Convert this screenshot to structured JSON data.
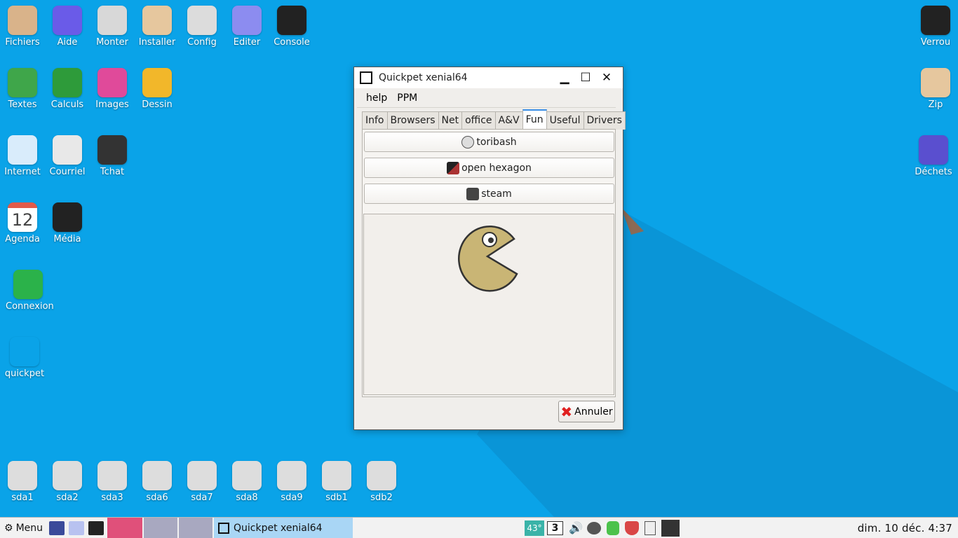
{
  "desktop": {
    "icons_top": [
      {
        "label": "Fichiers",
        "icon": "folder-home-icon",
        "color": "#d9b38a"
      },
      {
        "label": "Aide",
        "icon": "help-icon",
        "color": "#6a5be8"
      },
      {
        "label": "Monter",
        "icon": "drive-icon",
        "color": "#d8d8d8"
      },
      {
        "label": "Installer",
        "icon": "box-icon",
        "color": "#e6c79e"
      },
      {
        "label": "Config",
        "icon": "settings-icon",
        "color": "#dcdcdc"
      },
      {
        "label": "Editer",
        "icon": "editor-icon",
        "color": "#8c8cf0"
      },
      {
        "label": "Console",
        "icon": "terminal-icon",
        "color": "#222222"
      },
      {
        "label": "Textes",
        "icon": "writer-icon",
        "color": "#3fa64a"
      },
      {
        "label": "Calculs",
        "icon": "spreadsheet-icon",
        "color": "#2e9b3a"
      },
      {
        "label": "Images",
        "icon": "image-viewer-icon",
        "color": "#e04a9a"
      },
      {
        "label": "Dessin",
        "icon": "draw-icon",
        "color": "#f2b72a"
      },
      {
        "label": "Internet",
        "icon": "cloud-icon",
        "color": "#d9ecfb"
      },
      {
        "label": "Courriel",
        "icon": "mail-icon",
        "color": "#e8e8e8"
      },
      {
        "label": "Tchat",
        "icon": "chat-icon",
        "color": "#333333"
      },
      {
        "label": "Agenda",
        "icon": "calendar-icon",
        "color": "#ffffff",
        "text": "12"
      },
      {
        "label": "Média",
        "icon": "clapper-icon",
        "color": "#222222"
      },
      {
        "label": "Connexion",
        "icon": "connect-icon",
        "color": "#2bb24a"
      },
      {
        "label": "quickpet",
        "icon": "puppy-icon",
        "color": "transparent"
      }
    ],
    "icons_right": [
      {
        "label": "Verrou",
        "icon": "lock-icon",
        "color": "#222222"
      },
      {
        "label": "Zip",
        "icon": "archive-icon",
        "color": "#e6c79e"
      },
      {
        "label": "Déchets",
        "icon": "trash-icon",
        "color": "#5a4fcf"
      }
    ],
    "drives": [
      "sda1",
      "sda2",
      "sda3",
      "sda6",
      "sda7",
      "sda8",
      "sda9",
      "sdb1",
      "sdb2"
    ]
  },
  "window": {
    "title": "Quickpet xenial64",
    "menu": [
      "help",
      "PPM"
    ],
    "tabs": [
      "Info",
      "Browsers",
      "Net",
      "office",
      "A&V",
      "Fun",
      "Useful",
      "Drivers"
    ],
    "active_tab": "Fun",
    "buttons": [
      {
        "label": "toribash",
        "icon": "toribash-icon"
      },
      {
        "label": "open hexagon",
        "icon": "hexagon-icon"
      },
      {
        "label": "steam",
        "icon": "steam-icon"
      }
    ],
    "cancel_label": "Annuler"
  },
  "taskbar": {
    "menu_label": "Menu",
    "active_window": "Quickpet xenial64",
    "temperature": "43°",
    "workspace": "3",
    "clock": "dim. 10 déc.  4:37"
  }
}
